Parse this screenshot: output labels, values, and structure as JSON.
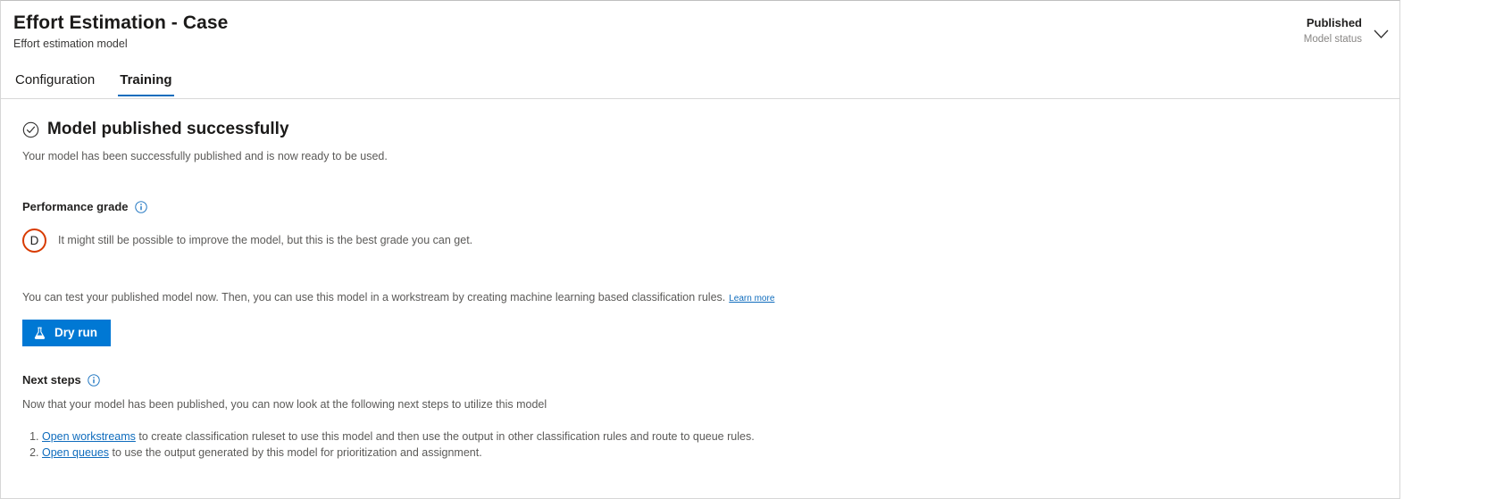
{
  "header": {
    "title": "Effort Estimation - Case",
    "subtitle": "Effort estimation model",
    "status_value": "Published",
    "status_label": "Model status",
    "chevron_icon": "chevron-down-icon"
  },
  "tabs": [
    {
      "label": "Configuration",
      "active": false
    },
    {
      "label": "Training",
      "active": true
    }
  ],
  "success": {
    "icon": "check-circle-icon",
    "title": "Model published successfully",
    "subtitle": "Your model has been successfully published and is now ready to be used."
  },
  "performance": {
    "heading": "Performance grade",
    "info_icon": "info-icon",
    "grade": "D",
    "grade_color": "#d83b01",
    "description": "It might still be possible to improve the model, but this is the best grade you can get."
  },
  "test": {
    "text": "You can test your published model now. Then, you can use this model in a workstream by creating machine learning based classification rules.",
    "learn_more": "Learn more",
    "dry_run_label": "Dry run",
    "dry_run_icon": "flask-icon",
    "accent_color": "#0078d4"
  },
  "next_steps": {
    "heading": "Next steps",
    "info_icon": "info-icon",
    "subtitle": "Now that your model has been published, you can now look at the following next steps to utilize this model",
    "items": [
      {
        "link": "Open workstreams",
        "text": " to create classification ruleset to use this model and then use the output in other classification rules and route to queue rules."
      },
      {
        "link": "Open queues",
        "text": " to use the output generated by this model for prioritization and assignment."
      }
    ]
  }
}
